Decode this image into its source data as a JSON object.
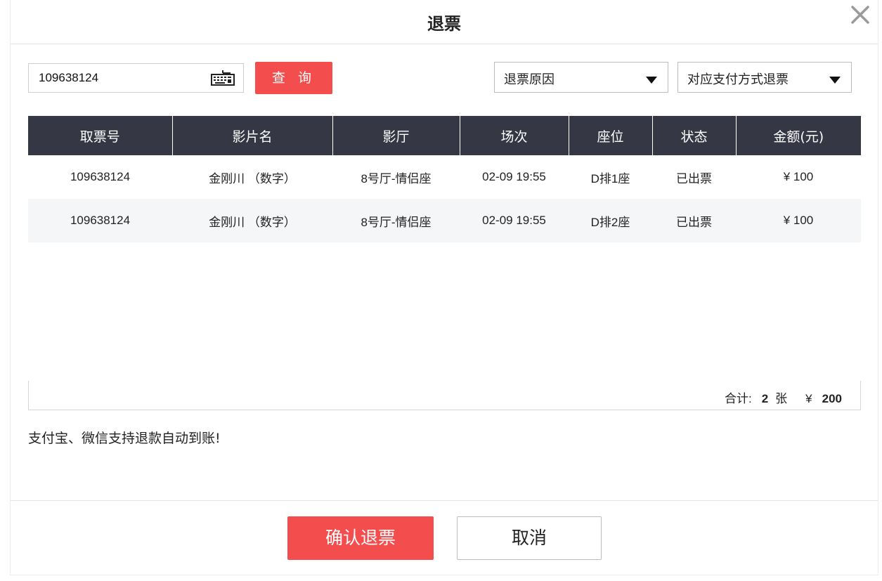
{
  "dialog": {
    "title": "退票",
    "close_icon": "close-icon"
  },
  "search": {
    "value": "109638124",
    "keyboard_icon": "keyboard-icon",
    "query_label": "查 询"
  },
  "filters": {
    "reason": {
      "selected": "退票原因",
      "icon": "caret-down-icon"
    },
    "refund_method": {
      "selected": "对应支付方式退票",
      "icon": "caret-down-icon"
    }
  },
  "table": {
    "headers": [
      "取票号",
      "影片名",
      "影厅",
      "场次",
      "座位",
      "状态",
      "金额(元)"
    ],
    "rows": [
      [
        "109638124",
        "金刚川 （数字）",
        "8号厅-情侣座",
        "02-09 19:55",
        "D排1座",
        "已出票",
        "¥ 100"
      ],
      [
        "109638124",
        "金刚川 （数字）",
        "8号厅-情侣座",
        "02-09 19:55",
        "D排2座",
        "已出票",
        "¥ 100"
      ]
    ]
  },
  "summary": {
    "label": "合计:",
    "count": "2",
    "unit": "张",
    "currency": "¥",
    "total": "200"
  },
  "notice": "支付宝、微信支持退款自动到账!",
  "footer": {
    "confirm_label": "确认退票",
    "cancel_label": "取消"
  },
  "colors": {
    "accent": "#f44d4d",
    "header_bg": "#363745",
    "row_alt": "#f5f6f8"
  }
}
